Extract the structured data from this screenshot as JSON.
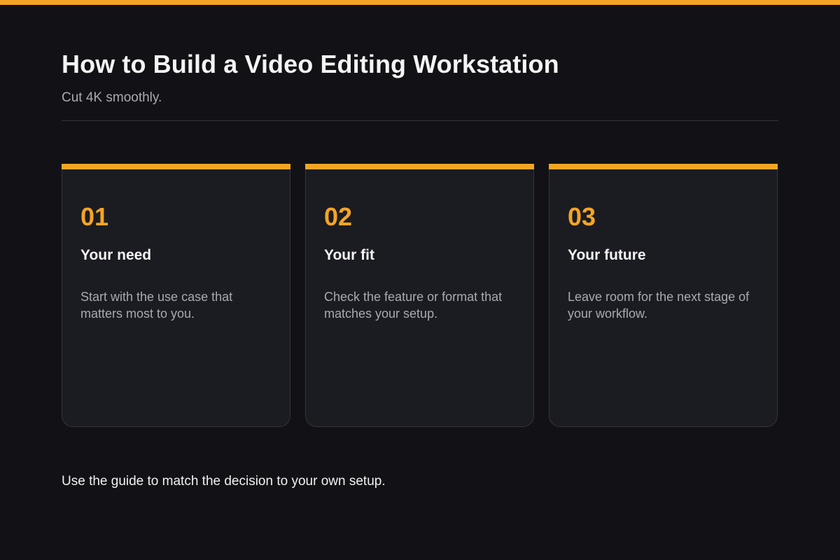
{
  "page": {
    "title": "How to Build a Video Editing Workstation",
    "subtitle": "Cut 4K smoothly.",
    "footer": "Use the guide to match the decision to your own setup."
  },
  "cards": [
    {
      "number": "01",
      "title": "Your need",
      "body": "Start with the use case that matters most to you."
    },
    {
      "number": "02",
      "title": "Your fit",
      "body": "Check the feature or format that matches your setup."
    },
    {
      "number": "03",
      "title": "Your future",
      "body": "Leave room for the next stage of your workflow."
    }
  ],
  "colors": {
    "accent": "#F5A524",
    "background": "#121216",
    "card_background": "#1B1C21",
    "title_text": "#F4F4F5",
    "muted_text": "#A9A9B0"
  }
}
